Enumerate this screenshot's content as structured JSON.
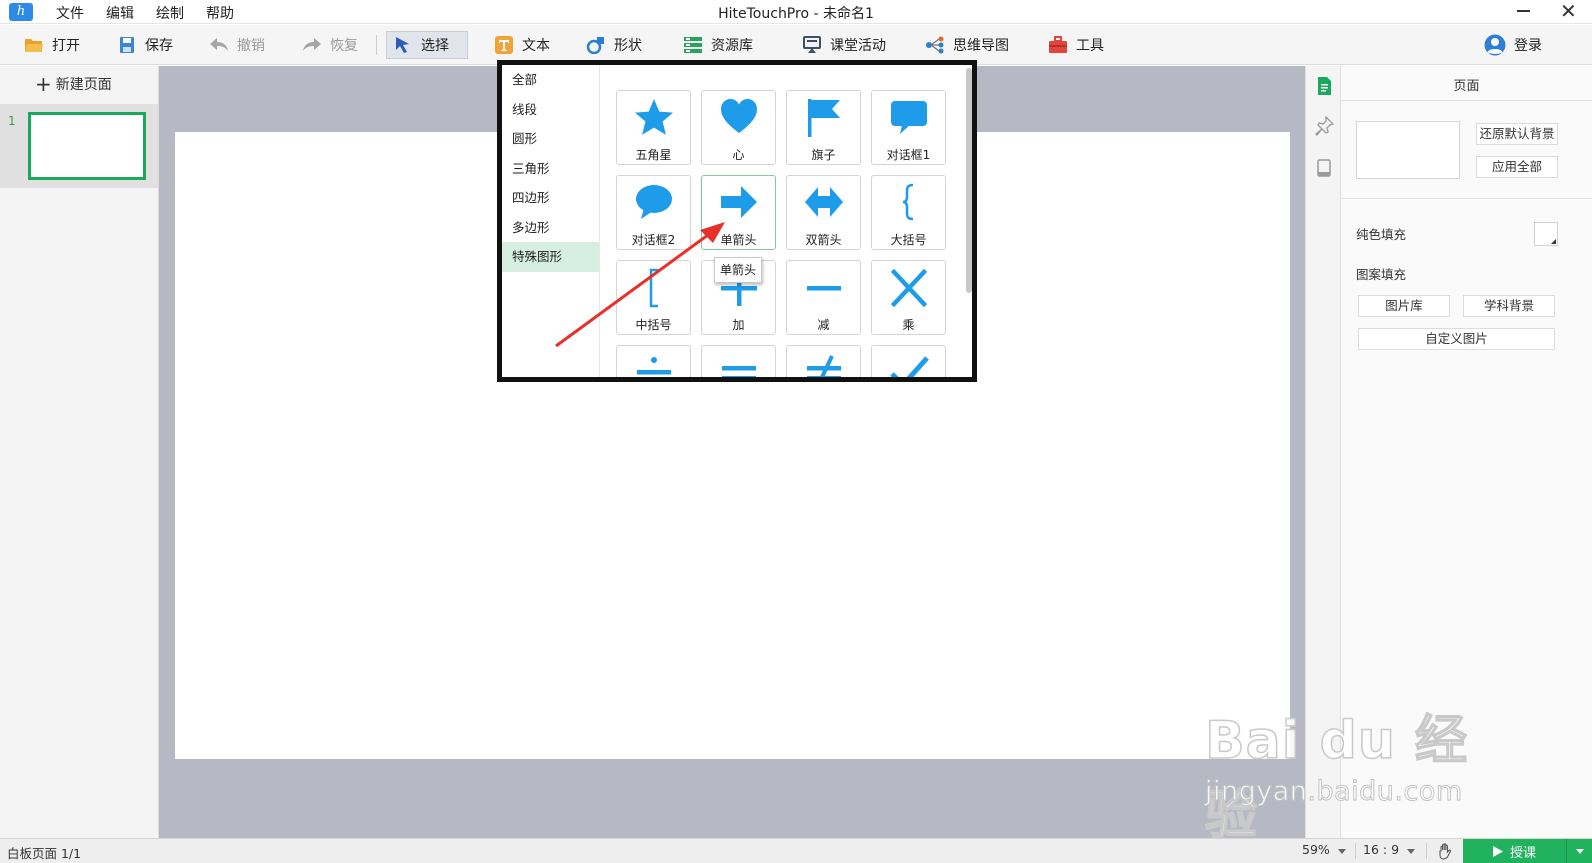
{
  "app": {
    "window_title": "HiteTouchPro - 未命名1"
  },
  "menu": [
    "文件",
    "编辑",
    "绘制",
    "帮助"
  ],
  "toolbar": {
    "open": "打开",
    "save": "保存",
    "undo": "撤销",
    "redo": "恢复",
    "select": "选择",
    "text": "文本",
    "shape": "形状",
    "resources": "资源库",
    "activity": "课堂活动",
    "mindmap": "思维导图",
    "tools": "工具",
    "login": "登录"
  },
  "left_panel": {
    "new_page": "新建页面",
    "pages": [
      {
        "number": "1"
      }
    ]
  },
  "shape_popup": {
    "categories": [
      "全部",
      "线段",
      "圆形",
      "三角形",
      "四边形",
      "多边形",
      "特殊图形"
    ],
    "selected_category": "特殊图形",
    "shapes": [
      "五角星",
      "心",
      "旗子",
      "对话框1",
      "对话框2",
      "单箭头",
      "双箭头",
      "大括号",
      "中括号",
      "加",
      "减",
      "乘"
    ],
    "tooltip": "单箭头",
    "accent_color": "#1e9be9"
  },
  "right_panel": {
    "title": "页面",
    "restore_bg": "还原默认背景",
    "apply_all": "应用全部",
    "solid_fill": "纯色填充",
    "pattern_fill": "图案填充",
    "gallery": "图片库",
    "subject_bg": "学科背景",
    "custom_image": "自定义图片"
  },
  "statusbar": {
    "page_counter": "白板页面 1/1",
    "zoom": "59%",
    "ratio": "16 : 9",
    "present": "授课",
    "present_color": "#21b25d"
  },
  "watermark": {
    "brand": "Bai du 经验",
    "url": "jingyan.baidu.com"
  }
}
